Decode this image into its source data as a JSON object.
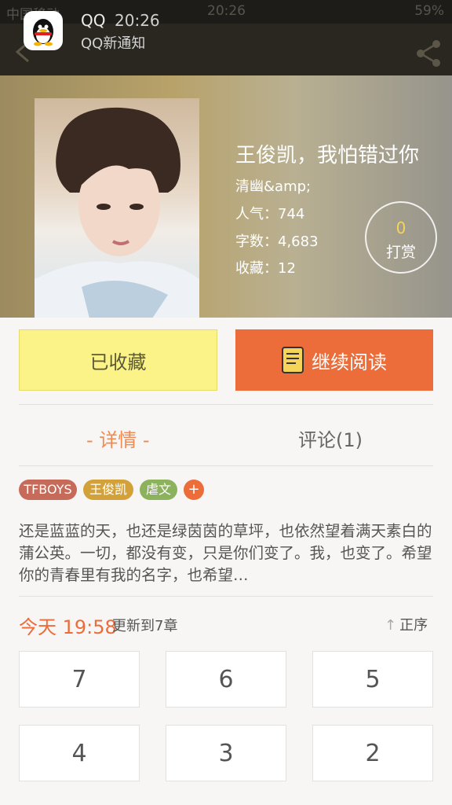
{
  "status_bar": {
    "carrier": "中国移动",
    "time": "20:26",
    "battery": "59%"
  },
  "notification": {
    "app": "QQ",
    "time": "20:26",
    "text": "QQ新通知"
  },
  "book": {
    "title": "王俊凯，我怕错过你",
    "author": "清幽&amp;",
    "popularity": "人气：744",
    "word_count": "字数：4,683",
    "favorites": "收藏：12",
    "tip_count": "0",
    "tip_label": "打赏"
  },
  "actions": {
    "favorited": "已收藏",
    "continue_reading": "继续阅读"
  },
  "tabs": {
    "detail": "- 详情 -",
    "comments": "评论(1)"
  },
  "tags": [
    {
      "label": "TFBOYS",
      "color": "#c66a5a"
    },
    {
      "label": "王俊凯",
      "color": "#d3a13a"
    },
    {
      "label": "虐文",
      "color": "#8cb25e"
    }
  ],
  "tag_add": "+",
  "description": "还是蓝蓝的天，也还是绿茵茵的草坪，也依然望着满天素白的蒲公英。一切，都没有变，只是你们变了。我，也变了。希望你的青春里有我的名字，也希望…",
  "update": {
    "time": "今天 19:58",
    "text": "更新到7章",
    "sort": "正序"
  },
  "chapters": [
    "7",
    "6",
    "5",
    "4",
    "3",
    "2"
  ]
}
